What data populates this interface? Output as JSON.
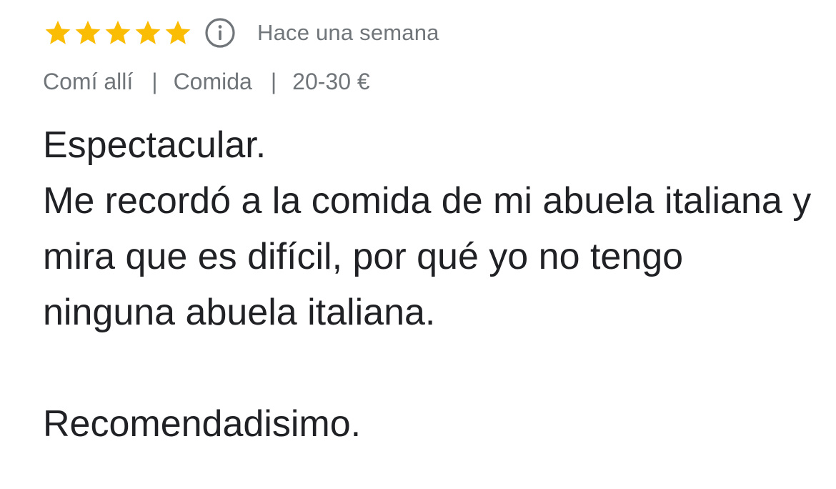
{
  "review": {
    "rating": 5,
    "rating_max": 5,
    "star_color": "#fbbc04",
    "star_icon": "star-icon",
    "info_icon": "info-icon",
    "time_ago": "Hace una semana",
    "meta": {
      "service": "Comí allí",
      "meal": "Comida",
      "price": "20-30 €",
      "separator": "|"
    },
    "text": "Espectacular.\nMe recordó a la comida de mi abuela italiana y mira que es difícil, por qué yo no tengo ninguna abuela italiana.\n\nRecomendadisimo."
  }
}
